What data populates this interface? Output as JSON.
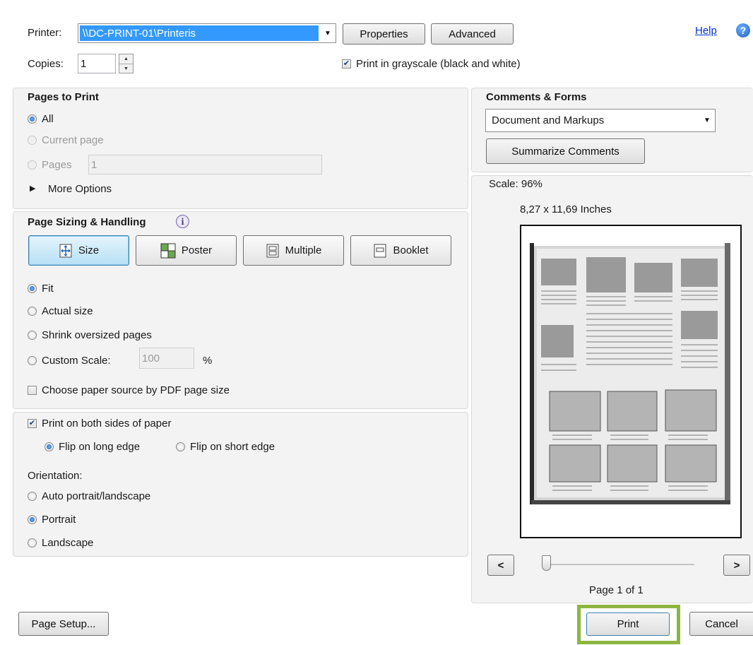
{
  "printer": {
    "label": "Printer:",
    "value": "\\\\DC-PRINT-01\\Printeris",
    "properties_label": "Properties",
    "advanced_label": "Advanced",
    "help_label": "Help"
  },
  "copies": {
    "label": "Copies:",
    "value": "1",
    "grayscale_label": "Print in grayscale (black and white)",
    "grayscale_checked": true
  },
  "pages_to_print": {
    "title": "Pages to Print",
    "all_label": "All",
    "current_label": "Current page",
    "pages_label": "Pages",
    "pages_value": "1",
    "more_options_label": "More Options",
    "selected": "All"
  },
  "sizing": {
    "title": "Page Sizing & Handling",
    "tools": [
      "Size",
      "Poster",
      "Multiple",
      "Booklet"
    ],
    "active_tool": "Size",
    "fit_label": "Fit",
    "actual_label": "Actual size",
    "shrink_label": "Shrink oversized pages",
    "custom_label": "Custom Scale:",
    "custom_value": "100",
    "percent": "%",
    "paper_source_label": "Choose paper source by PDF page size",
    "selected": "Fit"
  },
  "duplex": {
    "both_sides_label": "Print on both sides of paper",
    "both_sides_checked": true,
    "long_edge_label": "Flip on long edge",
    "short_edge_label": "Flip on short edge",
    "selected": "Flip on long edge"
  },
  "orientation": {
    "label": "Orientation:",
    "auto_label": "Auto portrait/landscape",
    "portrait_label": "Portrait",
    "landscape_label": "Landscape",
    "selected": "Portrait"
  },
  "comments": {
    "title": "Comments & Forms",
    "value": "Document and Markups",
    "summarize_label": "Summarize Comments"
  },
  "preview": {
    "scale_label": "Scale: 96%",
    "paper_size": "8,27 x 11,69 Inches",
    "prev_label": "<",
    "next_label": ">",
    "page_label": "Page 1 of 1"
  },
  "footer": {
    "page_setup_label": "Page Setup...",
    "print_label": "Print",
    "cancel_label": "Cancel"
  },
  "colors": {
    "highlight": "#8db640",
    "selection": "#3399ff",
    "link": "#0033cc"
  }
}
